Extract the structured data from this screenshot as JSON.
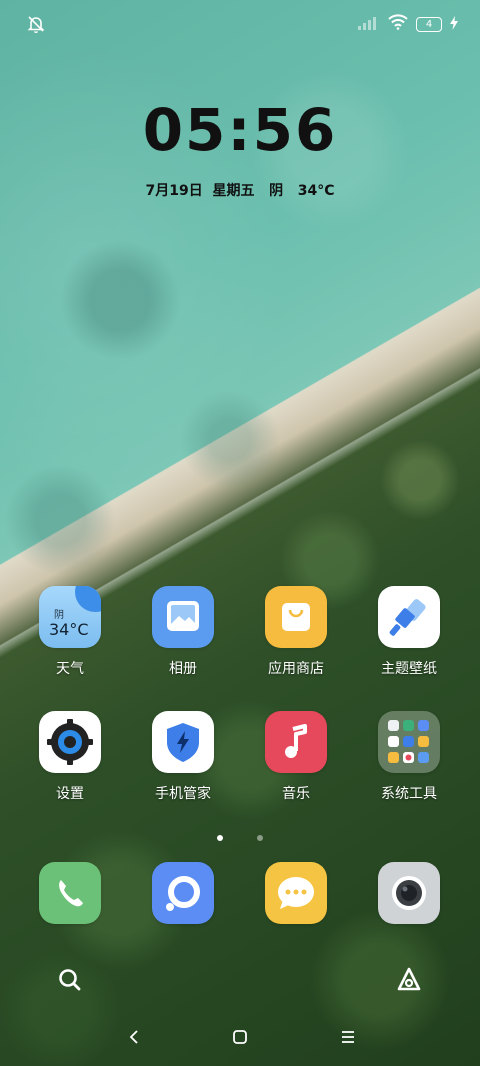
{
  "status_bar": {
    "battery": "4"
  },
  "lockclock": {
    "time": "05:56",
    "date": "7月19日",
    "weekday": "星期五",
    "weather": "阴",
    "temp": "34°C"
  },
  "weather_widget": {
    "condition": "阴",
    "temp": "34°C"
  },
  "apps_row1": [
    {
      "label": "天气"
    },
    {
      "label": "相册"
    },
    {
      "label": "应用商店"
    },
    {
      "label": "主题壁纸"
    }
  ],
  "apps_row2": [
    {
      "label": "设置"
    },
    {
      "label": "手机管家"
    },
    {
      "label": "音乐"
    },
    {
      "label": "系统工具"
    }
  ],
  "dock": [
    "phone-icon",
    "browser-icon",
    "messages-icon",
    "camera-icon"
  ],
  "colors": {
    "weather_bg": "#8ec9f3",
    "gallery_bg": "#5b9cf0",
    "store_bg": "#f5bc3f",
    "music_bg": "#e6495c",
    "phone_bg": "#6cc178",
    "browser_bg": "#5b8df5",
    "messages_bg": "#f5c443",
    "camera_bg": "#cfd3d6"
  }
}
